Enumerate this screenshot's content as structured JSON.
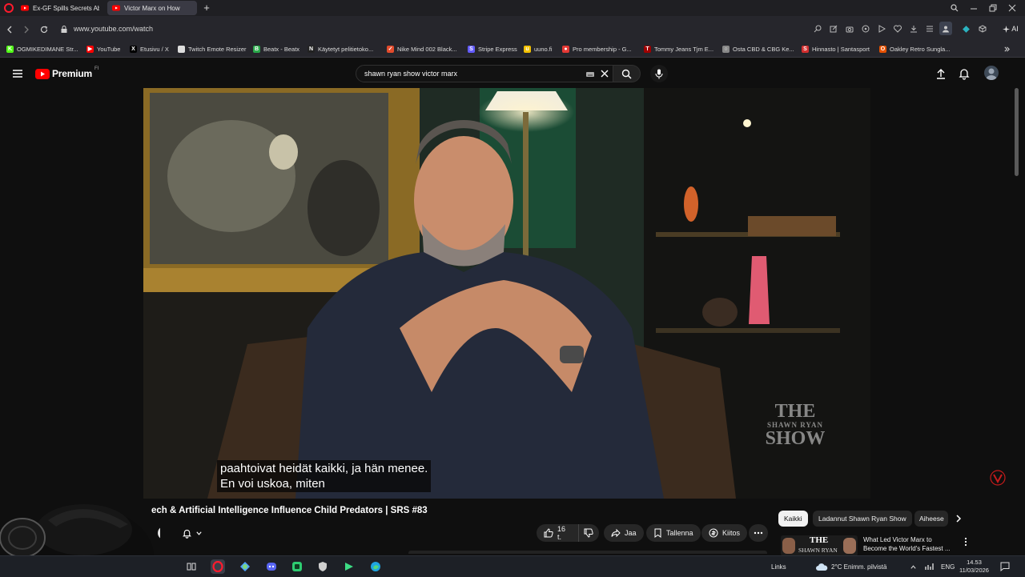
{
  "browser": {
    "tabs": [
      {
        "label": "Ex-GF Spills Secrets About",
        "active": false
      },
      {
        "label": "Victor Marx on How",
        "active": true
      }
    ],
    "url": "www.youtube.com/watch",
    "ai_label": "AI"
  },
  "bookmarks": [
    {
      "label": "OGMIKEDIMANE Str...",
      "icon": "kick-icon",
      "color": "#53fc18"
    },
    {
      "label": "YouTube",
      "icon": "youtube-icon",
      "color": "#ff0000"
    },
    {
      "label": "Etusivu / X",
      "icon": "x-icon",
      "color": "#000000"
    },
    {
      "label": "Twitch Emote Resizer",
      "icon": "page-icon",
      "color": "#dddddd"
    },
    {
      "label": "Beatx - Beatx",
      "icon": "beatx-icon",
      "color": "#2aa84a"
    },
    {
      "label": "Käytetyt pelitietoko...",
      "icon": "n-icon",
      "color": "#222222"
    },
    {
      "label": "Nike Mind 002 Black...",
      "icon": "nike-icon",
      "color": "#e34b2c"
    },
    {
      "label": "Stripe Express",
      "icon": "stripe-icon",
      "color": "#635bff"
    },
    {
      "label": "uuno.fi",
      "icon": "uuno-icon",
      "color": "#f2c100"
    },
    {
      "label": "Pro membership - G...",
      "icon": "pin-icon",
      "color": "#e53935"
    },
    {
      "label": "Tommy Jeans Tjm E...",
      "icon": "tommy-icon",
      "color": "#a00000"
    },
    {
      "label": "Osta CBD & CBG Ke...",
      "icon": "globe-icon",
      "color": "#888888"
    },
    {
      "label": "Hinnasto | Santasport",
      "icon": "santa-icon",
      "color": "#d32f2f"
    },
    {
      "label": "Oakley Retro Sungla...",
      "icon": "oakley-icon",
      "color": "#e65100"
    }
  ],
  "youtube": {
    "logo_text": "Premium",
    "logo_sup": "FI",
    "search_value": "shawn ryan show victor marx"
  },
  "video": {
    "subtitle_lines": [
      "paahtoivat heidät kaikki, ja hän menee.",
      "En voi uskoa, miten"
    ],
    "watermark": {
      "line1": "THE",
      "line2": "SHAWN RYAN",
      "line3": "SHOW"
    },
    "title": "ech & Artificial Intelligence Influence Child Predators | SRS #83",
    "like_count": "16 t.",
    "share_label": "Jaa",
    "save_label": "Tallenna",
    "thanks_label": "Kiitos"
  },
  "recommendations": {
    "chips": [
      "Kaikki",
      "Ladannut Shawn Ryan Show",
      "Aiheese"
    ],
    "item": {
      "title_line1": "What Led Victor Marx to",
      "title_line2": "Become the World's Fastest ...",
      "thumb_text1": "THE",
      "thumb_text2": "SHAWN RYAN"
    }
  },
  "taskbar": {
    "links_label": "Links",
    "weather": "2°C  Enimm. pilvistä",
    "language": "ENG",
    "time": "14.53",
    "date": "11/03/2026"
  }
}
